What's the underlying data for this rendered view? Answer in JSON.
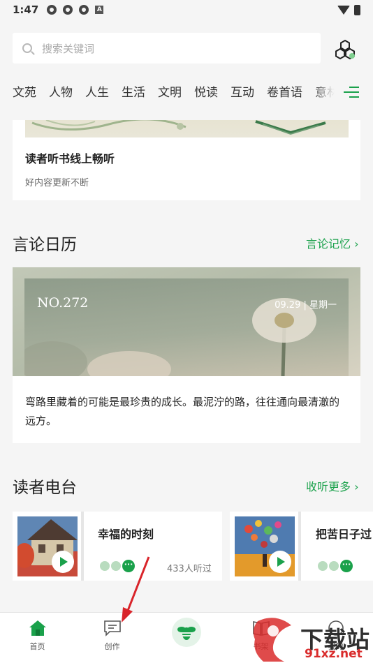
{
  "status_bar": {
    "time": "1:47",
    "badge": "A"
  },
  "search": {
    "placeholder": "搜索关键词"
  },
  "tabs": [
    "文苑",
    "人物",
    "人生",
    "生活",
    "文明",
    "悦读",
    "互动",
    "卷首语",
    "意林"
  ],
  "audiobook_card": {
    "title": "读者听书线上畅听",
    "subtitle": "好内容更新不断"
  },
  "calendar_section": {
    "title": "言论日历",
    "link": "言论记忆 ›",
    "number": "NO.272",
    "date": "09.29 | 星期一",
    "quote": "弯路里藏着的可能是最珍贵的成长。最泥泞的路，往往通向最清澈的远方。"
  },
  "radio_section": {
    "title": "读者电台",
    "link": "收听更多 ›",
    "items": [
      {
        "title": "幸福的时刻",
        "listeners": "433人听过"
      },
      {
        "title": "把苦日子过"
      }
    ]
  },
  "bottom_nav": {
    "home": "首页",
    "create": "创作",
    "shelf": "书架",
    "mine": "我的"
  },
  "watermark": {
    "line1": "下载站",
    "line2": "91xz.net"
  },
  "colors": {
    "accent": "#1aa14b",
    "background": "#f5f5f5",
    "arrow": "#d9242a"
  }
}
